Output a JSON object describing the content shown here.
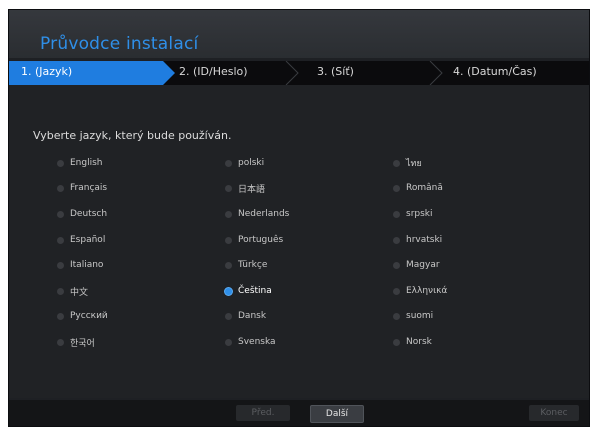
{
  "title": "Průvodce instalací",
  "steps": [
    {
      "label": "1.  (Jazyk)",
      "active": true
    },
    {
      "label": "2.  (ID/Heslo)",
      "active": false
    },
    {
      "label": "3.  (Síť)",
      "active": false
    },
    {
      "label": "4.  (Datum/Čas)",
      "active": false
    }
  ],
  "prompt": "Vyberte jazyk, který bude používán.",
  "languages": {
    "col1": [
      "English",
      "Français",
      "Deutsch",
      "Español",
      "Italiano",
      "中文",
      "Русский",
      "한국어"
    ],
    "col2": [
      "polski",
      "日本語",
      "Nederlands",
      "Português",
      "Türkçe",
      "Čeština",
      "Dansk",
      "Svenska"
    ],
    "col3": [
      "ไทย",
      "Română",
      "srpski",
      "hrvatski",
      "Magyar",
      "Ελληνικά",
      "suomi",
      "Norsk"
    ]
  },
  "selected_language": "Čeština",
  "buttons": {
    "prev": "Před.",
    "next": "Další",
    "finish": "Konec"
  },
  "colors": {
    "accent": "#1f7de0",
    "title": "#2f8fe8"
  }
}
